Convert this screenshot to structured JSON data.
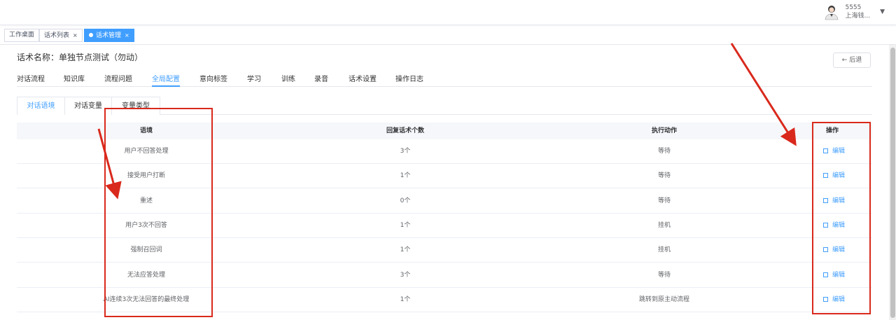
{
  "user": {
    "id": "5555",
    "name": "上海钱..."
  },
  "tags": [
    {
      "label": "工作桌面",
      "closable": false,
      "active": false
    },
    {
      "label": "话术列表",
      "closable": true,
      "active": false
    },
    {
      "label": "话术管理",
      "closable": true,
      "active": true
    }
  ],
  "tag_close_glyph": "×",
  "page": {
    "title": "话术名称：单独节点测试（勿动）",
    "back_label": "后退",
    "back_icon": "←"
  },
  "nav_tabs": [
    "对话流程",
    "知识库",
    "流程问题",
    "全局配置",
    "意向标签",
    "学习",
    "训练",
    "录音",
    "话术设置",
    "操作日志"
  ],
  "nav_active": "全局配置",
  "sub_tabs": [
    "对话语境",
    "对话变量",
    "变量类型"
  ],
  "sub_active": "对话语境",
  "table": {
    "headers": [
      "语境",
      "回复话术个数",
      "执行动作",
      "操作"
    ],
    "rows": [
      {
        "context": "用户不回答处理",
        "count": "3个",
        "action": "等待",
        "op": "编辑"
      },
      {
        "context": "接受用户打断",
        "count": "1个",
        "action": "等待",
        "op": "编辑"
      },
      {
        "context": "重述",
        "count": "0个",
        "action": "等待",
        "op": "编辑"
      },
      {
        "context": "用户3次不回答",
        "count": "1个",
        "action": "挂机",
        "op": "编辑"
      },
      {
        "context": "强制召回词",
        "count": "1个",
        "action": "挂机",
        "op": "编辑"
      },
      {
        "context": "无法应答处理",
        "count": "3个",
        "action": "等待",
        "op": "编辑"
      },
      {
        "context": "AI连续3次无法回答的最终处理",
        "count": "1个",
        "action": "跳转到原主动流程",
        "op": "编辑"
      }
    ]
  },
  "colors": {
    "accent": "#409eff",
    "annotation": "#d9291c"
  },
  "icons": [
    "user-avatar-icon",
    "caret-down-icon",
    "back-arrow-icon",
    "edit-icon"
  ]
}
